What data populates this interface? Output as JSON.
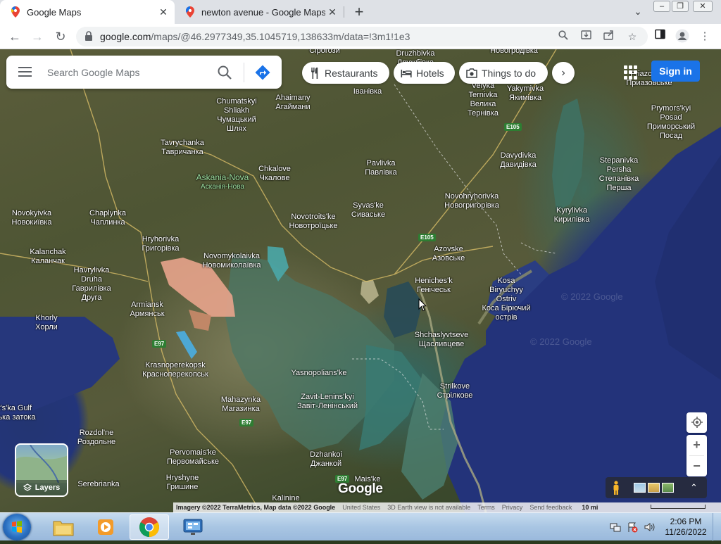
{
  "browser": {
    "tabs": [
      {
        "title": "Google Maps",
        "active": true
      },
      {
        "title": "newton avenue - Google Maps",
        "active": false
      }
    ],
    "new_tab": "+",
    "url_host": "google.com",
    "url_path": "/maps/@46.2977349,35.1045719,138633m/data=!3m1!1e3"
  },
  "maps": {
    "search_placeholder": "Search Google Maps",
    "chips": [
      "Restaurants",
      "Hotels",
      "Things to do"
    ],
    "sign_in": "Sign in",
    "layers_label": "Layers",
    "google_logo": "Google",
    "watermarks": [
      "© 2022 Google",
      "© 2022 Google"
    ],
    "attribution": {
      "imagery": "Imagery ©2022 TerraMetrics, Map data ©2022 Google",
      "country": "United States",
      "earth_view": "3D Earth view is not available",
      "terms": "Terms",
      "privacy": "Privacy",
      "feedback": "Send feedback",
      "scale": "10 mi"
    },
    "roads": [
      "E105",
      "E105",
      "E97",
      "E97",
      "E97"
    ],
    "places": [
      {
        "lines": [
          "Сірогози"
        ]
      },
      {
        "lines": [
          "Druzhbivka",
          "Дружбівка"
        ]
      },
      {
        "lines": [
          "Novohrodivka",
          "Новогродівка"
        ]
      },
      {
        "lines": [
          "Іванівка"
        ]
      },
      {
        "lines": [
          "Velyka",
          "Ternivka",
          "Велика",
          "Тернівка"
        ]
      },
      {
        "lines": [
          "Yakymivka",
          "Якимівка"
        ]
      },
      {
        "lines": [
          "Priazovske",
          "Приазовське"
        ]
      },
      {
        "lines": [
          "Chumatskyi",
          "Shliakh",
          "Чумацький",
          "Шлях"
        ]
      },
      {
        "lines": [
          "Ahaimany",
          "Агаймани"
        ]
      },
      {
        "lines": [
          "Prymors'kyi",
          "Posad",
          "Приморський",
          "Посад"
        ]
      },
      {
        "lines": [
          "Tavrychanka",
          "Тавричанка"
        ]
      },
      {
        "lines": [
          "Davydivka",
          "Давидівка"
        ]
      },
      {
        "lines": [
          "Askania-Nova",
          "Асканія-Нова"
        ],
        "green": true
      },
      {
        "lines": [
          "Chkalove",
          "Чкалове"
        ]
      },
      {
        "lines": [
          "Pavlivka",
          "Павлівка"
        ]
      },
      {
        "lines": [
          "Stepanivka",
          "Persha",
          "Степанівка",
          "Перша"
        ]
      },
      {
        "lines": [
          "Syvas'ke",
          "Сиваське"
        ]
      },
      {
        "lines": [
          "Novohryhorivka",
          "Новогригорівка"
        ]
      },
      {
        "lines": [
          "Novokyivka",
          "Новокиївка"
        ]
      },
      {
        "lines": [
          "Chaplynka",
          "Чаплинка"
        ]
      },
      {
        "lines": [
          "Novotroits'ke",
          "Новотроїцьке"
        ]
      },
      {
        "lines": [
          "Kyrylivka",
          "Кирилівка"
        ]
      },
      {
        "lines": [
          "Hryhorivka",
          "Григорівка"
        ]
      },
      {
        "lines": [
          "Novomykolaivka",
          "Новомиколаївка"
        ]
      },
      {
        "lines": [
          "Kalanchak",
          "Каланчак"
        ]
      },
      {
        "lines": [
          "Azovske",
          "Азовське"
        ]
      },
      {
        "lines": [
          "Havrylivka",
          "Druha",
          "Гаврилівка",
          "Друга"
        ]
      },
      {
        "lines": [
          "Heniches'k",
          "Генічеськ"
        ]
      },
      {
        "lines": [
          "Kosa",
          "Biryuchyy",
          "Ostriv",
          "Коса Бірючий",
          "острів"
        ]
      },
      {
        "lines": [
          "Armiansk",
          "Армянськ"
        ]
      },
      {
        "lines": [
          "Khorly",
          "Хорли"
        ]
      },
      {
        "lines": [
          "Shchaslyvtseve",
          "Щасливцеве"
        ]
      },
      {
        "lines": [
          "Krasnoperekopsk",
          "Красноперекопськ"
        ]
      },
      {
        "lines": [
          "Yasnopolians'ke"
        ]
      },
      {
        "lines": [
          "Strilkove",
          "Стрілкове"
        ]
      },
      {
        "lines": [
          "Mahazynka",
          "Магазинка"
        ]
      },
      {
        "lines": [
          "Zavit-Lenins'kyi",
          "Завіт-Ленінський"
        ]
      },
      {
        "lines": [
          "Rozdol'ne",
          "Роздольне"
        ]
      },
      {
        "lines": [
          "Pervomais'ke",
          "Первомайське"
        ]
      },
      {
        "lines": [
          "Dzhankoi",
          "Джанкой"
        ]
      },
      {
        "lines": [
          "Hryshyne",
          "Гришине"
        ]
      },
      {
        "lines": [
          "Serebrianka"
        ]
      },
      {
        "lines": [
          "Kalinine"
        ]
      },
      {
        "lines": [
          "Mais'ke"
        ]
      },
      {
        "lines": [
          "t's'ka Gulf",
          "ька затока"
        ]
      }
    ]
  },
  "taskbar": {
    "time": "2:06 PM",
    "date": "11/26/2022"
  }
}
